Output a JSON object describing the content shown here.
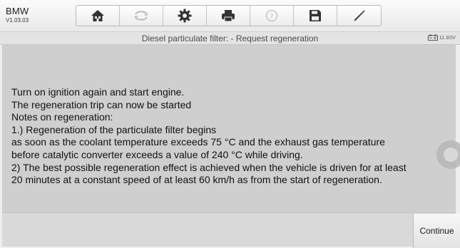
{
  "header": {
    "make": "BMW",
    "version": "V1.03.03"
  },
  "toolbar": {
    "buttons": [
      {
        "icon": "home-icon"
      },
      {
        "icon": "vehicle-swap-icon"
      },
      {
        "icon": "gear-icon"
      },
      {
        "icon": "printer-icon"
      },
      {
        "icon": "help-icon"
      },
      {
        "icon": "save-icon"
      },
      {
        "icon": "pen-icon"
      }
    ]
  },
  "titlebar": {
    "title": "Diesel particulate filter: - Request regeneration",
    "voltage": "11.83V"
  },
  "message": {
    "lines": [
      "Turn on ignition again and start engine.",
      "The regeneration trip can now be started",
      "Notes on regeneration:",
      "1.) Regeneration of the particulate filter begins",
      "as soon as the coolant temperature exceeds 75 °C and the exhaust gas temperature",
      "before catalytic converter exceeds a value of 240 °C while driving.",
      "2) The best possible regeneration effect is achieved when the vehicle is driven for at least",
      "20 minutes at a constant speed of at least 60 km/h as from the start of regeneration."
    ]
  },
  "footer": {
    "continue_label": "Continue"
  },
  "colors": {
    "content_bg": "#cfcfcf",
    "icon_dark": "#333333",
    "icon_disabled": "#bdbdbd"
  }
}
